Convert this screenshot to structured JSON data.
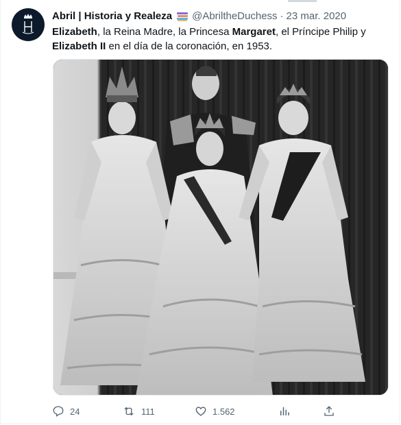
{
  "tweet": {
    "author": "Abril | Historia y Realeza",
    "author_emoji": "books-icon",
    "handle": "@AbriltheDuchess",
    "separator": "·",
    "date": "23 mar. 2020",
    "text_segments": [
      {
        "text": "Elizabeth",
        "bold": true
      },
      {
        "text": ", la Reina Madre, la Princesa ",
        "bold": false
      },
      {
        "text": "Margaret",
        "bold": true
      },
      {
        "text": ", el Príncipe Philip y ",
        "bold": false
      },
      {
        "text": "Elizabeth II",
        "bold": true
      },
      {
        "text": " en el día de la coronación, en 1953.",
        "bold": false
      }
    ],
    "media_description_icon": "photo-icon"
  },
  "actions": {
    "replies": "24",
    "retweets": "111",
    "likes": "1.562"
  },
  "colors": {
    "text": "#0f1419",
    "secondary": "#536471",
    "avatar_bg": "#0d1a2b"
  }
}
